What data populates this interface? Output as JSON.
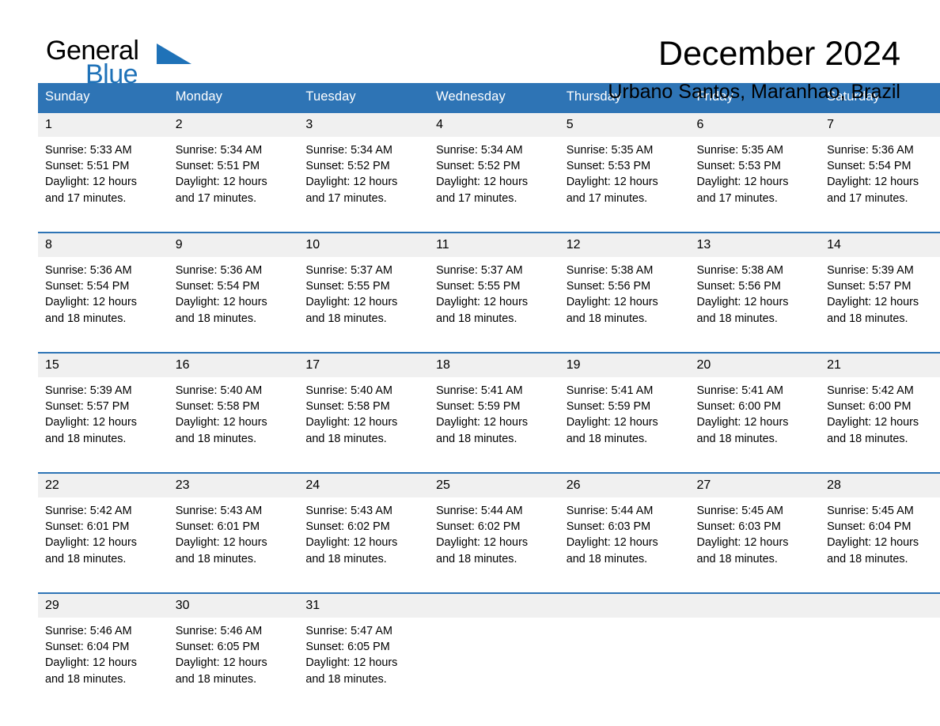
{
  "brand": {
    "name_part1": "General",
    "name_part2": "Blue",
    "accent_color": "#1f72b8"
  },
  "header": {
    "title": "December 2024",
    "subtitle": "Urbano Santos, Maranhao, Brazil",
    "header_bg_color": "#2e74b5"
  },
  "weekdays": [
    "Sunday",
    "Monday",
    "Tuesday",
    "Wednesday",
    "Thursday",
    "Friday",
    "Saturday"
  ],
  "weeks": [
    [
      {
        "day": "1",
        "sunrise": "Sunrise: 5:33 AM",
        "sunset": "Sunset: 5:51 PM",
        "daylight1": "Daylight: 12 hours",
        "daylight2": "and 17 minutes."
      },
      {
        "day": "2",
        "sunrise": "Sunrise: 5:34 AM",
        "sunset": "Sunset: 5:51 PM",
        "daylight1": "Daylight: 12 hours",
        "daylight2": "and 17 minutes."
      },
      {
        "day": "3",
        "sunrise": "Sunrise: 5:34 AM",
        "sunset": "Sunset: 5:52 PM",
        "daylight1": "Daylight: 12 hours",
        "daylight2": "and 17 minutes."
      },
      {
        "day": "4",
        "sunrise": "Sunrise: 5:34 AM",
        "sunset": "Sunset: 5:52 PM",
        "daylight1": "Daylight: 12 hours",
        "daylight2": "and 17 minutes."
      },
      {
        "day": "5",
        "sunrise": "Sunrise: 5:35 AM",
        "sunset": "Sunset: 5:53 PM",
        "daylight1": "Daylight: 12 hours",
        "daylight2": "and 17 minutes."
      },
      {
        "day": "6",
        "sunrise": "Sunrise: 5:35 AM",
        "sunset": "Sunset: 5:53 PM",
        "daylight1": "Daylight: 12 hours",
        "daylight2": "and 17 minutes."
      },
      {
        "day": "7",
        "sunrise": "Sunrise: 5:36 AM",
        "sunset": "Sunset: 5:54 PM",
        "daylight1": "Daylight: 12 hours",
        "daylight2": "and 17 minutes."
      }
    ],
    [
      {
        "day": "8",
        "sunrise": "Sunrise: 5:36 AM",
        "sunset": "Sunset: 5:54 PM",
        "daylight1": "Daylight: 12 hours",
        "daylight2": "and 18 minutes."
      },
      {
        "day": "9",
        "sunrise": "Sunrise: 5:36 AM",
        "sunset": "Sunset: 5:54 PM",
        "daylight1": "Daylight: 12 hours",
        "daylight2": "and 18 minutes."
      },
      {
        "day": "10",
        "sunrise": "Sunrise: 5:37 AM",
        "sunset": "Sunset: 5:55 PM",
        "daylight1": "Daylight: 12 hours",
        "daylight2": "and 18 minutes."
      },
      {
        "day": "11",
        "sunrise": "Sunrise: 5:37 AM",
        "sunset": "Sunset: 5:55 PM",
        "daylight1": "Daylight: 12 hours",
        "daylight2": "and 18 minutes."
      },
      {
        "day": "12",
        "sunrise": "Sunrise: 5:38 AM",
        "sunset": "Sunset: 5:56 PM",
        "daylight1": "Daylight: 12 hours",
        "daylight2": "and 18 minutes."
      },
      {
        "day": "13",
        "sunrise": "Sunrise: 5:38 AM",
        "sunset": "Sunset: 5:56 PM",
        "daylight1": "Daylight: 12 hours",
        "daylight2": "and 18 minutes."
      },
      {
        "day": "14",
        "sunrise": "Sunrise: 5:39 AM",
        "sunset": "Sunset: 5:57 PM",
        "daylight1": "Daylight: 12 hours",
        "daylight2": "and 18 minutes."
      }
    ],
    [
      {
        "day": "15",
        "sunrise": "Sunrise: 5:39 AM",
        "sunset": "Sunset: 5:57 PM",
        "daylight1": "Daylight: 12 hours",
        "daylight2": "and 18 minutes."
      },
      {
        "day": "16",
        "sunrise": "Sunrise: 5:40 AM",
        "sunset": "Sunset: 5:58 PM",
        "daylight1": "Daylight: 12 hours",
        "daylight2": "and 18 minutes."
      },
      {
        "day": "17",
        "sunrise": "Sunrise: 5:40 AM",
        "sunset": "Sunset: 5:58 PM",
        "daylight1": "Daylight: 12 hours",
        "daylight2": "and 18 minutes."
      },
      {
        "day": "18",
        "sunrise": "Sunrise: 5:41 AM",
        "sunset": "Sunset: 5:59 PM",
        "daylight1": "Daylight: 12 hours",
        "daylight2": "and 18 minutes."
      },
      {
        "day": "19",
        "sunrise": "Sunrise: 5:41 AM",
        "sunset": "Sunset: 5:59 PM",
        "daylight1": "Daylight: 12 hours",
        "daylight2": "and 18 minutes."
      },
      {
        "day": "20",
        "sunrise": "Sunrise: 5:41 AM",
        "sunset": "Sunset: 6:00 PM",
        "daylight1": "Daylight: 12 hours",
        "daylight2": "and 18 minutes."
      },
      {
        "day": "21",
        "sunrise": "Sunrise: 5:42 AM",
        "sunset": "Sunset: 6:00 PM",
        "daylight1": "Daylight: 12 hours",
        "daylight2": "and 18 minutes."
      }
    ],
    [
      {
        "day": "22",
        "sunrise": "Sunrise: 5:42 AM",
        "sunset": "Sunset: 6:01 PM",
        "daylight1": "Daylight: 12 hours",
        "daylight2": "and 18 minutes."
      },
      {
        "day": "23",
        "sunrise": "Sunrise: 5:43 AM",
        "sunset": "Sunset: 6:01 PM",
        "daylight1": "Daylight: 12 hours",
        "daylight2": "and 18 minutes."
      },
      {
        "day": "24",
        "sunrise": "Sunrise: 5:43 AM",
        "sunset": "Sunset: 6:02 PM",
        "daylight1": "Daylight: 12 hours",
        "daylight2": "and 18 minutes."
      },
      {
        "day": "25",
        "sunrise": "Sunrise: 5:44 AM",
        "sunset": "Sunset: 6:02 PM",
        "daylight1": "Daylight: 12 hours",
        "daylight2": "and 18 minutes."
      },
      {
        "day": "26",
        "sunrise": "Sunrise: 5:44 AM",
        "sunset": "Sunset: 6:03 PM",
        "daylight1": "Daylight: 12 hours",
        "daylight2": "and 18 minutes."
      },
      {
        "day": "27",
        "sunrise": "Sunrise: 5:45 AM",
        "sunset": "Sunset: 6:03 PM",
        "daylight1": "Daylight: 12 hours",
        "daylight2": "and 18 minutes."
      },
      {
        "day": "28",
        "sunrise": "Sunrise: 5:45 AM",
        "sunset": "Sunset: 6:04 PM",
        "daylight1": "Daylight: 12 hours",
        "daylight2": "and 18 minutes."
      }
    ],
    [
      {
        "day": "29",
        "sunrise": "Sunrise: 5:46 AM",
        "sunset": "Sunset: 6:04 PM",
        "daylight1": "Daylight: 12 hours",
        "daylight2": "and 18 minutes."
      },
      {
        "day": "30",
        "sunrise": "Sunrise: 5:46 AM",
        "sunset": "Sunset: 6:05 PM",
        "daylight1": "Daylight: 12 hours",
        "daylight2": "and 18 minutes."
      },
      {
        "day": "31",
        "sunrise": "Sunrise: 5:47 AM",
        "sunset": "Sunset: 6:05 PM",
        "daylight1": "Daylight: 12 hours",
        "daylight2": "and 18 minutes."
      },
      {
        "day": "",
        "sunrise": "",
        "sunset": "",
        "daylight1": "",
        "daylight2": ""
      },
      {
        "day": "",
        "sunrise": "",
        "sunset": "",
        "daylight1": "",
        "daylight2": ""
      },
      {
        "day": "",
        "sunrise": "",
        "sunset": "",
        "daylight1": "",
        "daylight2": ""
      },
      {
        "day": "",
        "sunrise": "",
        "sunset": "",
        "daylight1": "",
        "daylight2": ""
      }
    ]
  ]
}
